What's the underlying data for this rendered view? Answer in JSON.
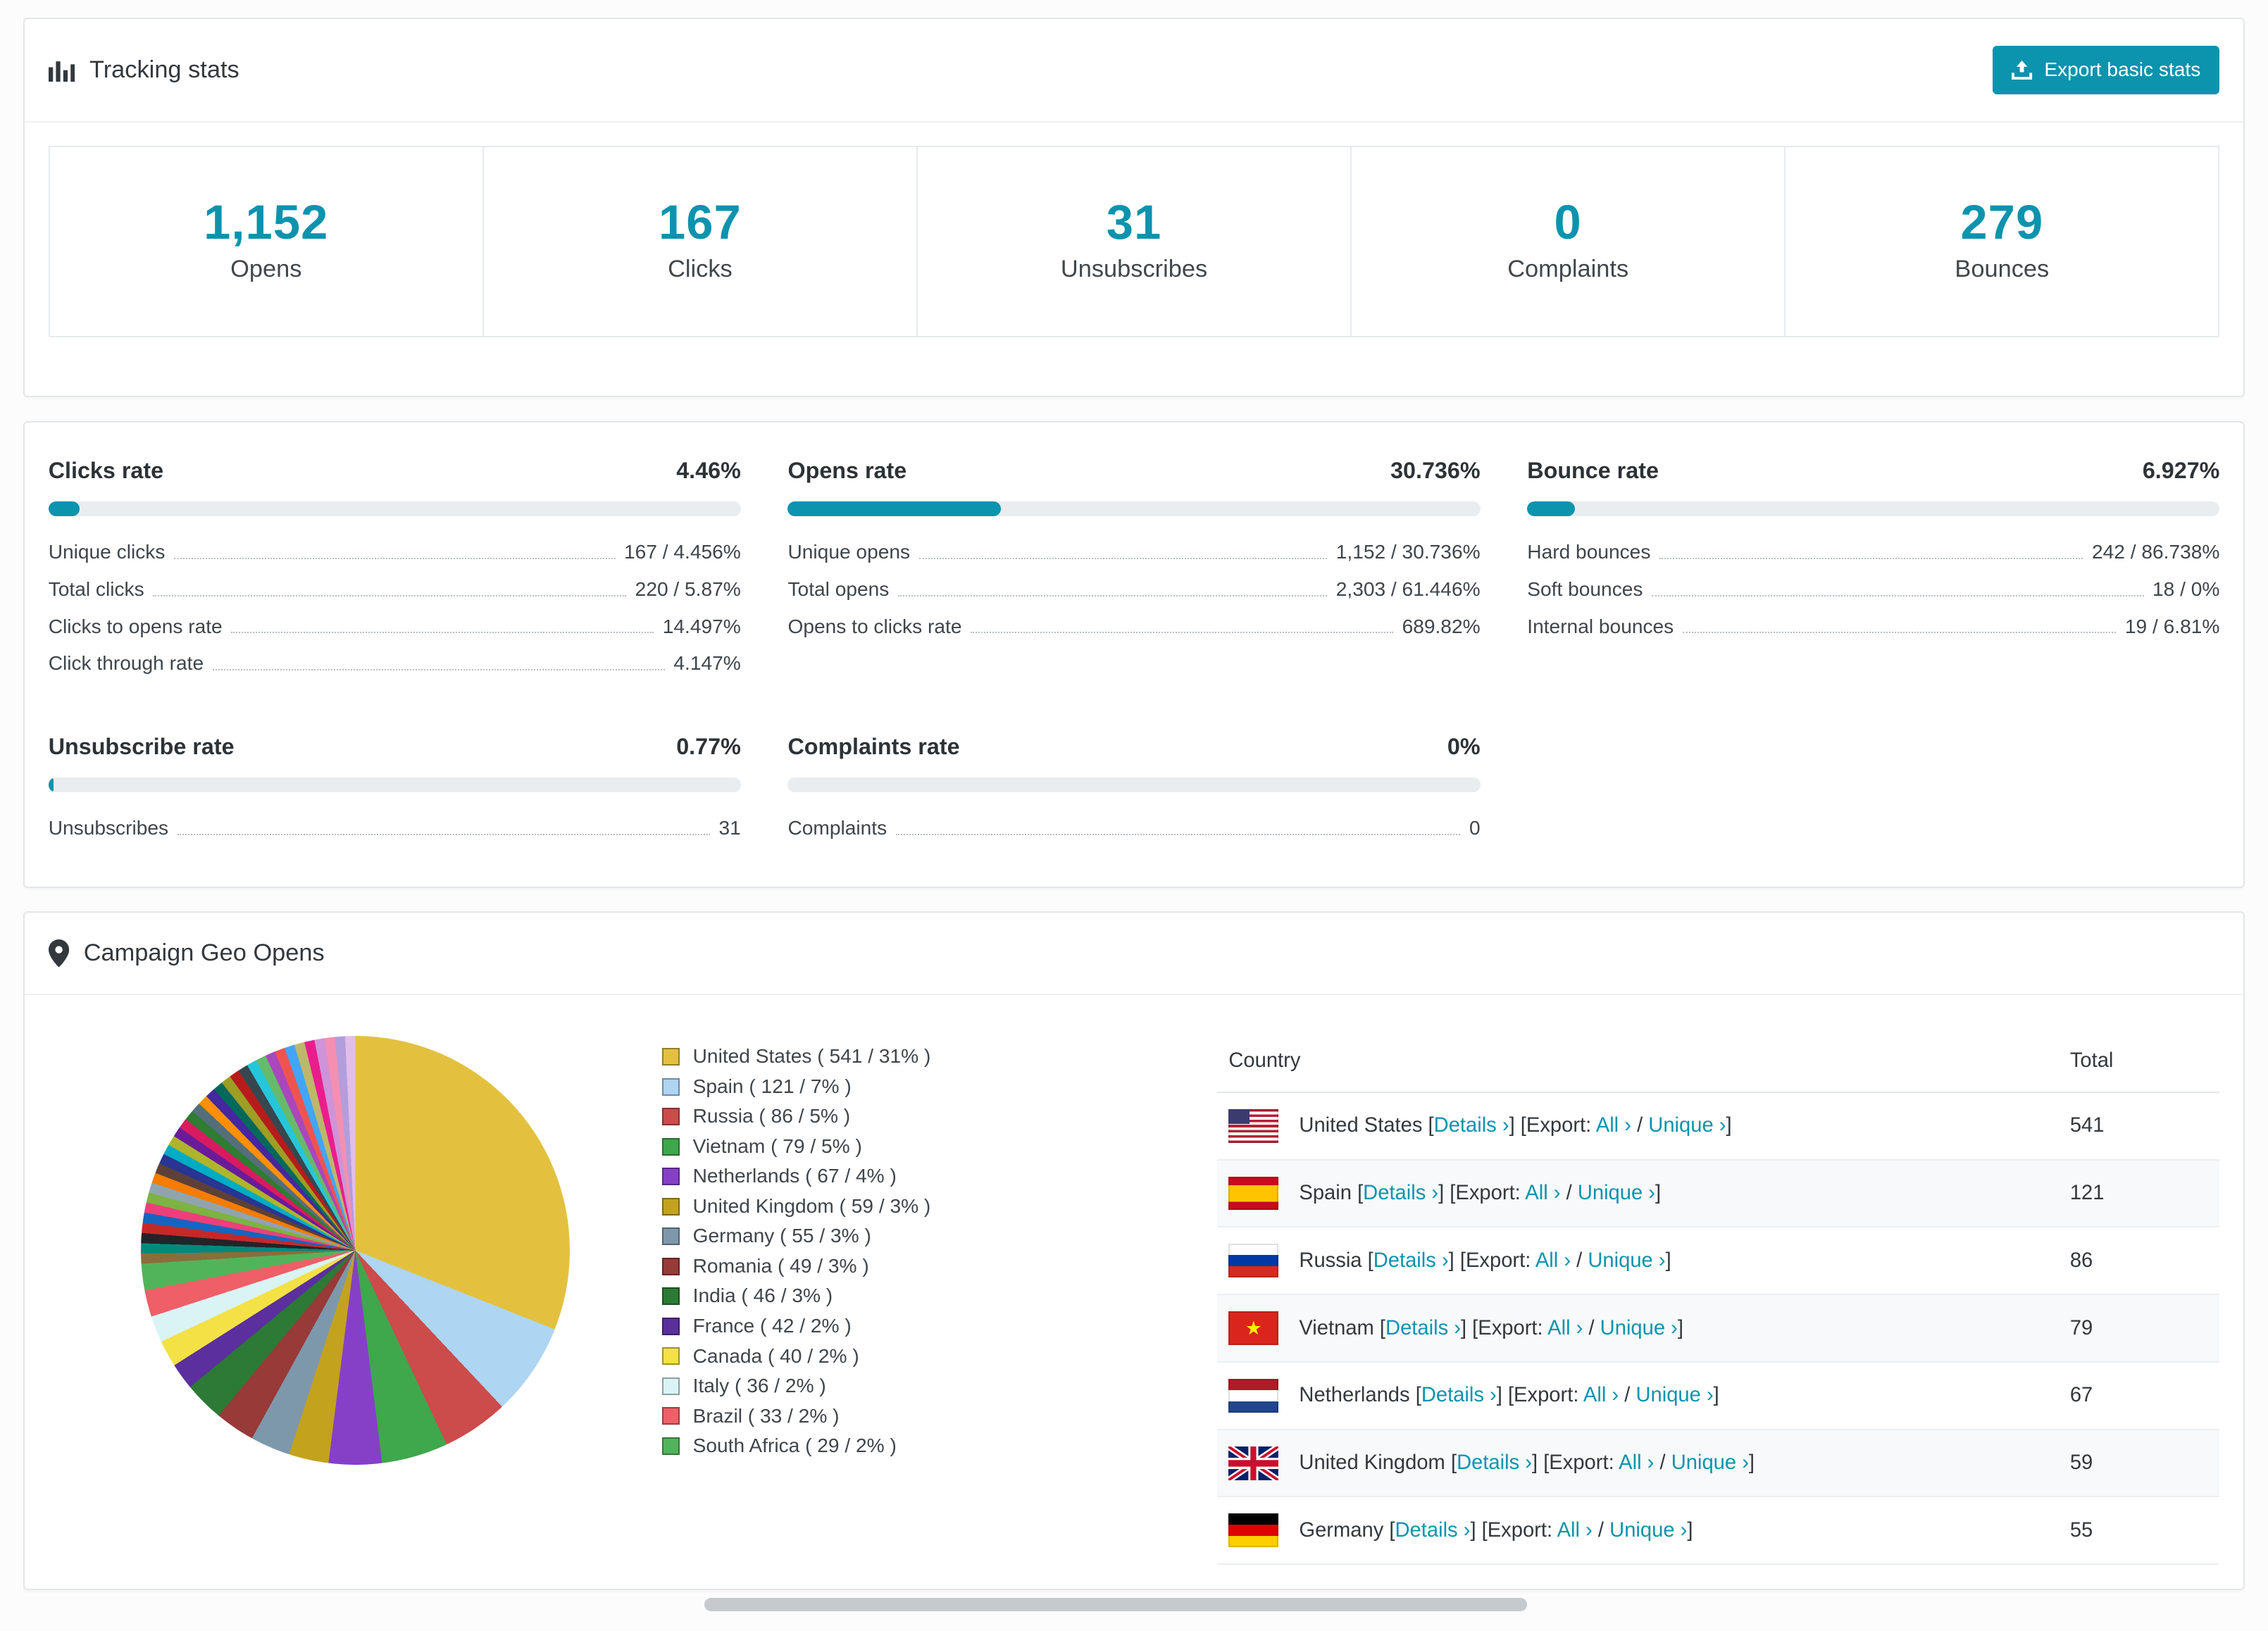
{
  "colors": {
    "accent": "#0c93ae",
    "bar_track": "#e9edef"
  },
  "tracking": {
    "title": "Tracking stats",
    "export_button": "Export basic stats",
    "stats": [
      {
        "value": "1,152",
        "label": "Opens"
      },
      {
        "value": "167",
        "label": "Clicks"
      },
      {
        "value": "31",
        "label": "Unsubscribes"
      },
      {
        "value": "0",
        "label": "Complaints"
      },
      {
        "value": "279",
        "label": "Bounces"
      }
    ]
  },
  "rates": [
    {
      "title": "Clicks rate",
      "value": "4.46%",
      "percent": 4.46,
      "rows": [
        {
          "label": "Unique clicks",
          "value": "167 / 4.456%"
        },
        {
          "label": "Total clicks",
          "value": "220 / 5.87%"
        },
        {
          "label": "Clicks to opens rate",
          "value": "14.497%"
        },
        {
          "label": "Click through rate",
          "value": "4.147%"
        }
      ]
    },
    {
      "title": "Opens rate",
      "value": "30.736%",
      "percent": 30.736,
      "rows": [
        {
          "label": "Unique opens",
          "value": "1,152 / 30.736%"
        },
        {
          "label": "Total opens",
          "value": "2,303 / 61.446%"
        },
        {
          "label": "Opens to clicks rate",
          "value": "689.82%"
        }
      ]
    },
    {
      "title": "Bounce rate",
      "value": "6.927%",
      "percent": 6.927,
      "rows": [
        {
          "label": "Hard bounces",
          "value": "242 / 86.738%"
        },
        {
          "label": "Soft bounces",
          "value": "18 / 0%"
        },
        {
          "label": "Internal bounces",
          "value": "19 / 6.81%"
        }
      ]
    },
    {
      "title": "Unsubscribe rate",
      "value": "0.77%",
      "percent": 0.77,
      "rows": [
        {
          "label": "Unsubscribes",
          "value": "31"
        }
      ]
    },
    {
      "title": "Complaints rate",
      "value": "0%",
      "percent": 0,
      "rows": [
        {
          "label": "Complaints",
          "value": "0"
        }
      ]
    }
  ],
  "chart_data": {
    "type": "pie",
    "title": "Campaign Geo Opens",
    "legend_position": "right",
    "slices": [
      {
        "label": "United States",
        "count": 541,
        "percent": 31,
        "color": "#e3c13f"
      },
      {
        "label": "Spain",
        "count": 121,
        "percent": 7,
        "color": "#aed5f2"
      },
      {
        "label": "Russia",
        "count": 86,
        "percent": 5,
        "color": "#cc4b4b"
      },
      {
        "label": "Vietnam",
        "count": 79,
        "percent": 5,
        "color": "#3fa74c"
      },
      {
        "label": "Netherlands",
        "count": 67,
        "percent": 4,
        "color": "#8640c8"
      },
      {
        "label": "United Kingdom",
        "count": 59,
        "percent": 3,
        "color": "#c3a21d"
      },
      {
        "label": "Germany",
        "count": 55,
        "percent": 3,
        "color": "#7e98ab"
      },
      {
        "label": "Romania",
        "count": 49,
        "percent": 3,
        "color": "#973a38"
      },
      {
        "label": "India",
        "count": 46,
        "percent": 3,
        "color": "#2c7a35"
      },
      {
        "label": "France",
        "count": 42,
        "percent": 2,
        "color": "#5b2f9e"
      },
      {
        "label": "Canada",
        "count": 40,
        "percent": 2,
        "color": "#f3e145"
      },
      {
        "label": "Italy",
        "count": 36,
        "percent": 2,
        "color": "#daf4f6"
      },
      {
        "label": "Brazil",
        "count": 33,
        "percent": 2,
        "color": "#ee5f67"
      },
      {
        "label": "South Africa",
        "count": 29,
        "percent": 2,
        "color": "#52b45a"
      }
    ],
    "others": {
      "percent": 26,
      "colors": [
        "#8a6d3b",
        "#00897b",
        "#222428",
        "#c62828",
        "#1565c0",
        "#ec407a",
        "#7cb342",
        "#90a4ae",
        "#f57c00",
        "#5d4037",
        "#283593",
        "#00acc1",
        "#afb42b",
        "#6a1b9a",
        "#d81b60",
        "#2e7d32",
        "#546e7a",
        "#ff8f00",
        "#4527a0",
        "#00695c",
        "#9e9d24",
        "#b71c1c",
        "#37474f",
        "#26c6da",
        "#66bb6a",
        "#ab47bc",
        "#ef5350",
        "#42a5f5",
        "#bdb76b",
        "#e91e8c",
        "#ce93d8",
        "#f48fb1",
        "#b39ddb",
        "#e1bee7"
      ]
    }
  },
  "geo": {
    "title": "Campaign Geo Opens",
    "table": {
      "headers": [
        "Country",
        "Total"
      ],
      "link_labels": {
        "details": "Details",
        "export": "Export:",
        "all": "All",
        "unique": "Unique",
        "chevron": "›"
      },
      "rows": [
        {
          "country": "United States",
          "flag": "us",
          "total": "541"
        },
        {
          "country": "Spain",
          "flag": "es",
          "total": "121"
        },
        {
          "country": "Russia",
          "flag": "ru",
          "total": "86"
        },
        {
          "country": "Vietnam",
          "flag": "vn",
          "total": "79"
        },
        {
          "country": "Netherlands",
          "flag": "nl",
          "total": "67"
        },
        {
          "country": "United Kingdom",
          "flag": "gb",
          "total": "59"
        },
        {
          "country": "Germany",
          "flag": "de",
          "total": "55"
        }
      ]
    }
  }
}
